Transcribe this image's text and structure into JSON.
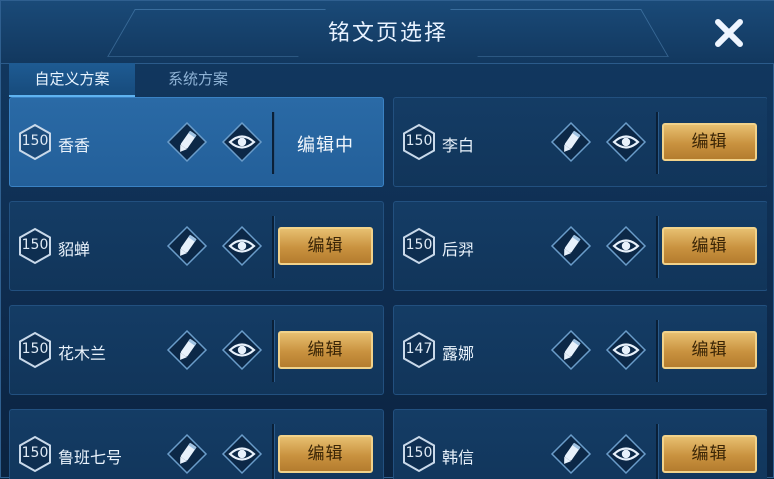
{
  "header": {
    "title": "铭文页选择",
    "close_icon": "close-icon"
  },
  "tabs": [
    {
      "label": "自定义方案",
      "active": true
    },
    {
      "label": "系统方案",
      "active": false
    }
  ],
  "pages": [
    {
      "level": "150",
      "name": "香香",
      "status": "编辑中",
      "selected": true
    },
    {
      "level": "150",
      "name": "李白",
      "status": "编辑",
      "selected": false
    },
    {
      "level": "150",
      "name": "貂蝉",
      "status": "编辑",
      "selected": false
    },
    {
      "level": "150",
      "name": "后羿",
      "status": "编辑",
      "selected": false
    },
    {
      "level": "150",
      "name": "花木兰",
      "status": "编辑",
      "selected": false
    },
    {
      "level": "147",
      "name": "露娜",
      "status": "编辑",
      "selected": false
    },
    {
      "level": "150",
      "name": "鲁班七号",
      "status": "编辑",
      "selected": false
    },
    {
      "level": "150",
      "name": "韩信",
      "status": "编辑",
      "selected": false
    }
  ],
  "icons": {
    "rename": "pencil-icon",
    "preview": "eye-icon",
    "level_badge": "hexagon-icon"
  },
  "colors": {
    "accent_gold": "#d9a955",
    "selected_card": "#2a6aa6",
    "card": "#143c65"
  }
}
